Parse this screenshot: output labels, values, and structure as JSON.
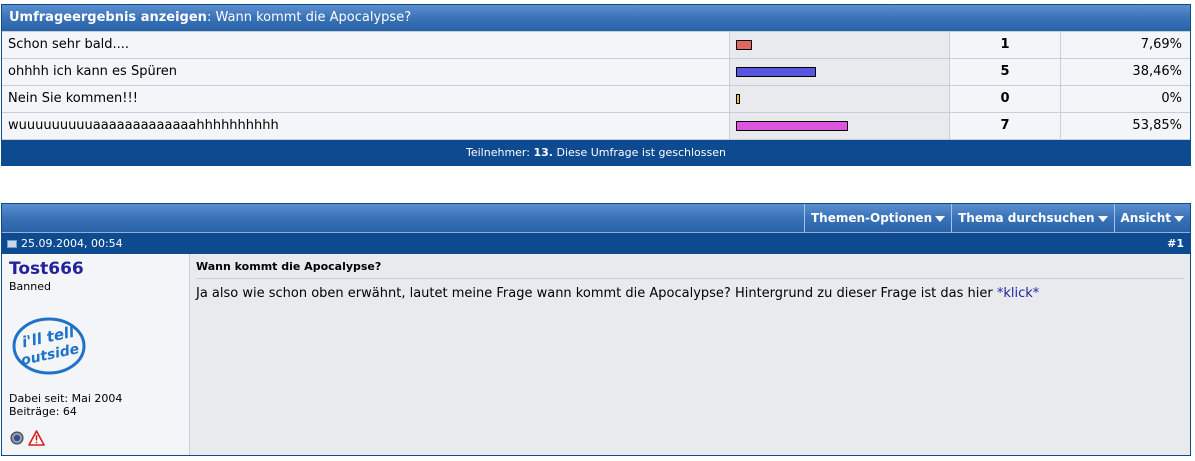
{
  "poll": {
    "header_label": "Umfrageergebnis anzeigen",
    "header_sep": ":",
    "question": "Wann kommt die Apocalypse?",
    "options": [
      {
        "label": "Schon sehr bald....",
        "votes": "1",
        "percent": "7,69%",
        "fraction": 0.0769,
        "color": "#e06666"
      },
      {
        "label": "ohhhh ich kann es Spüren",
        "votes": "5",
        "percent": "38,46%",
        "fraction": 0.3846,
        "color": "#5555dd"
      },
      {
        "label": "Nein Sie kommen!!!",
        "votes": "0",
        "percent": "0%",
        "fraction": 0,
        "color": "#e8c04a"
      },
      {
        "label": "wuuuuuuuuuaaaaaaaaaaaaahhhhhhhhhh",
        "votes": "7",
        "percent": "53,85%",
        "fraction": 0.5385,
        "color": "#dd55dd"
      }
    ],
    "footer_prefix": "Teilnehmer:",
    "participants": "13.",
    "footer_suffix": "Diese Umfrage ist geschlossen"
  },
  "thread_tools": {
    "options": "Themen-Optionen",
    "search": "Thema durchsuchen",
    "view": "Ansicht"
  },
  "post": {
    "date": "25.09.2004, 00:54",
    "number": "#1",
    "user": {
      "name": "Tost666",
      "title": "Banned",
      "avatar_text": "i'll tell outside",
      "joined": "Dabei seit: Mai 2004",
      "posts": "Beiträge: 64"
    },
    "title": "Wann kommt die Apocalypse?",
    "text": "Ja also wie schon oben erwähnt, lautet meine Frage wann kommt die Apocalypse? Hintergrund zu dieser Frage ist das hier",
    "link": "*klick*"
  },
  "colors": {
    "header_blue": "#3a72b8",
    "footer_blue": "#0d4a90",
    "username": "#22229c"
  }
}
